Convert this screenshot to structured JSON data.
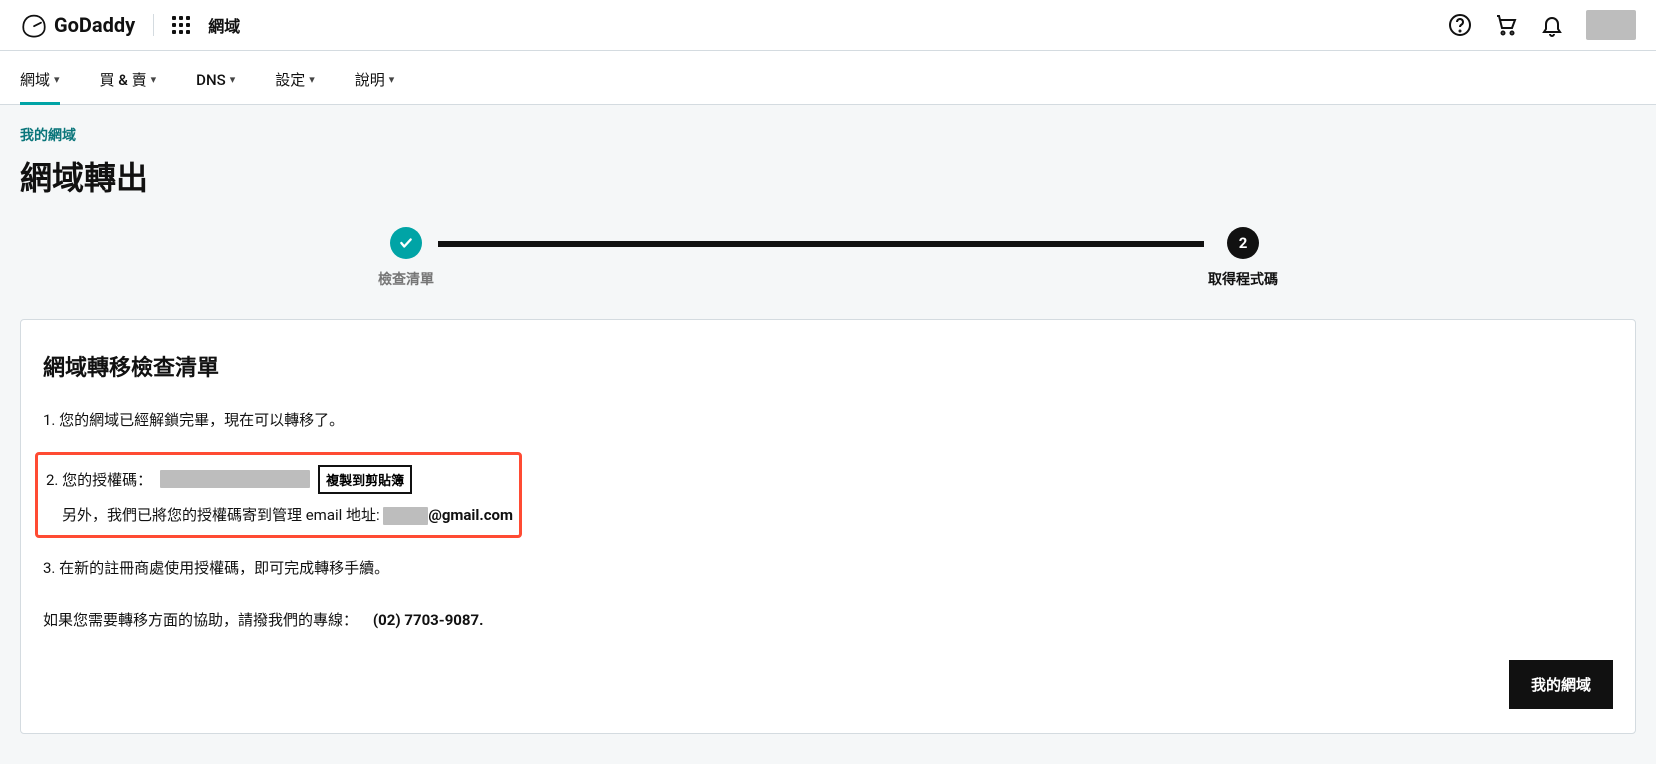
{
  "header": {
    "brand": "GoDaddy",
    "domain_label": "網域"
  },
  "nav": {
    "items": [
      {
        "label": "網域"
      },
      {
        "label": "買 & 賣"
      },
      {
        "label": "DNS"
      },
      {
        "label": "設定"
      },
      {
        "label": "說明"
      }
    ]
  },
  "breadcrumb": "我的網域",
  "page_title": "網域轉出",
  "stepper": {
    "step1_label": "檢查清單",
    "step2_number": "2",
    "step2_label": "取得程式碼"
  },
  "card": {
    "title": "網域轉移檢查清單",
    "item1": "1. 您的網域已經解鎖完畢，現在可以轉移了。",
    "item2_prefix": "2. 您的授權碼：",
    "copy_label": "複製到剪貼簿",
    "email_line_prefix": "另外，我們已將您的授權碼寄到管理 email 地址:",
    "email_suffix": "@gmail.com",
    "item3": "3. 在新的註冊商處使用授權碼，即可完成轉移手續。",
    "support_prefix": "如果您需要轉移方面的協助，請撥我們的專線：",
    "phone": "(02) 7703-9087.",
    "footer_button": "我的網域"
  }
}
